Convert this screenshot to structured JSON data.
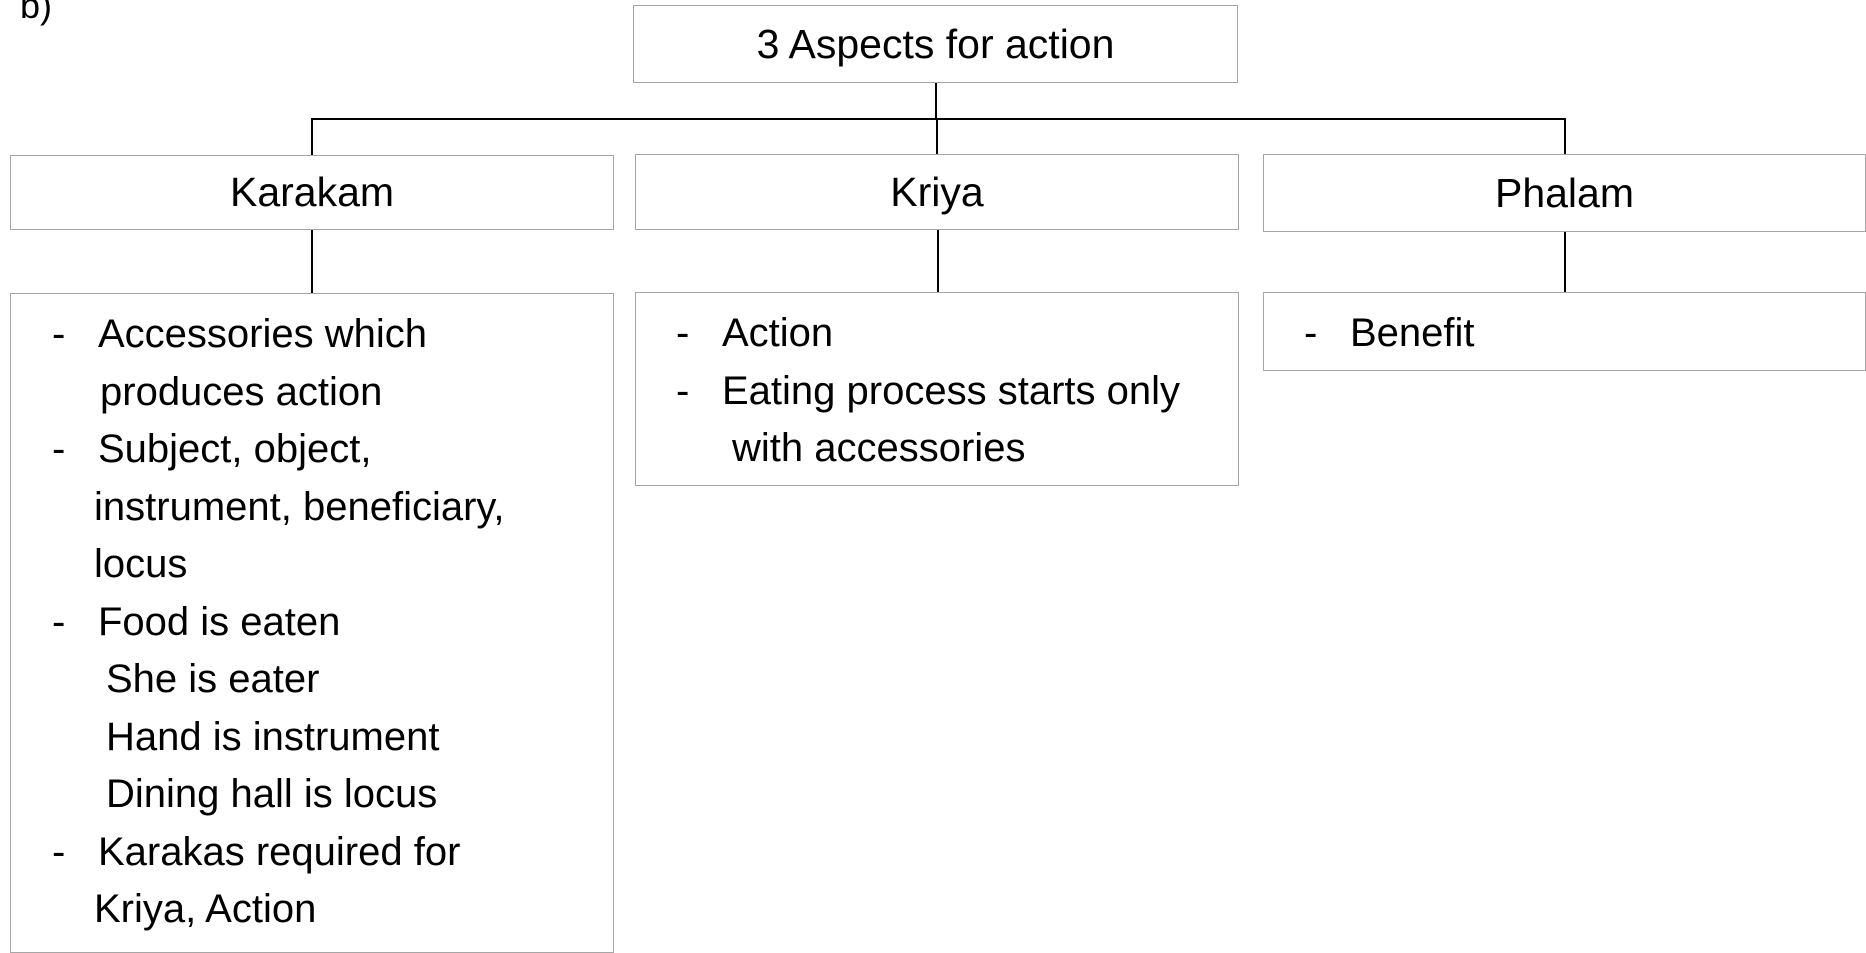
{
  "corner_label": "b)",
  "root": {
    "title": "3 Aspects for action"
  },
  "aspects": [
    {
      "title": "Karakam",
      "points": [
        {
          "lines": [
            "Accessories which",
            "produces action"
          ]
        },
        {
          "lines": [
            "Subject, object,",
            "instrument, beneficiary,",
            "locus"
          ]
        },
        {
          "lines": [
            "Food is eaten",
            "She is eater",
            "Hand is instrument",
            "Dining hall is locus"
          ]
        },
        {
          "lines": [
            "Karakas required for",
            "Kriya, Action"
          ]
        }
      ]
    },
    {
      "title": "Kriya",
      "points": [
        {
          "lines": [
            "Action"
          ]
        },
        {
          "lines": [
            "Eating process starts only",
            "with accessories"
          ]
        }
      ]
    },
    {
      "title": "Phalam",
      "points": [
        {
          "lines": [
            "Benefit"
          ]
        }
      ]
    }
  ],
  "bullet_marker": "-",
  "colors": {
    "box_border": "#a6a6a6",
    "connector": "#000000",
    "text": "#000000"
  }
}
